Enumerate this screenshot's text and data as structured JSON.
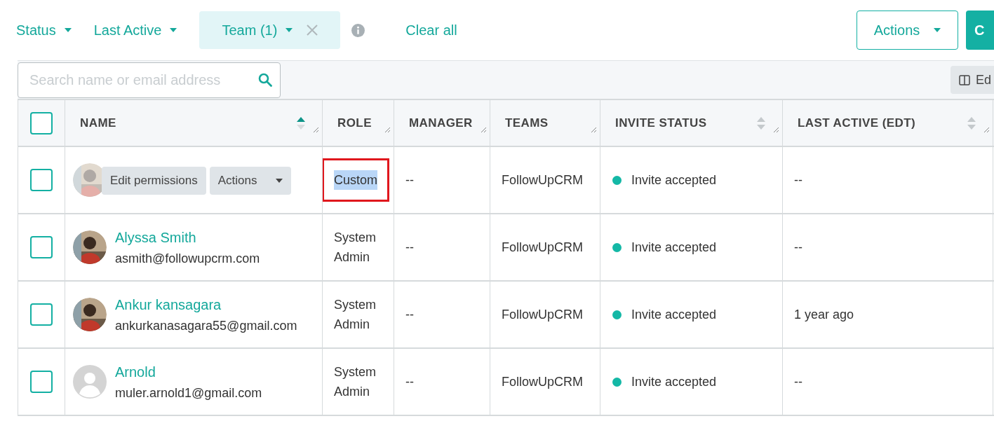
{
  "filters": [
    {
      "label": "Status",
      "active": false,
      "removable": false
    },
    {
      "label": "Last Active",
      "active": false,
      "removable": false
    },
    {
      "label": "Team (1)",
      "active": true,
      "removable": true
    }
  ],
  "clear_all": "Clear all",
  "actions_button": "Actions",
  "primary_button": "C",
  "search": {
    "placeholder": "Search name or email address"
  },
  "edit_columns_button": "Ed",
  "table": {
    "select_all": {
      "checked": false
    },
    "columns": [
      {
        "label": "NAME",
        "sortable": true,
        "sorted_ascending": true
      },
      {
        "label": "ROLE",
        "sortable": false
      },
      {
        "label": "MANAGER",
        "sortable": false
      },
      {
        "label": "TEAMS",
        "sortable": false
      },
      {
        "label": "INVITE STATUS",
        "sortable": true,
        "sorted_ascending": false
      },
      {
        "label": "LAST ACTIVE (EDT)",
        "sortable": true,
        "sorted_ascending": false
      }
    ],
    "rows": [
      {
        "checked": false,
        "avatar": {
          "kind": "picture"
        },
        "hovered": true,
        "row_actions": [
          "Edit permissions",
          "Actions"
        ],
        "role": "Custom",
        "role_highlighted": true,
        "manager": "--",
        "teams": "FollowUpCRM",
        "invite_status": "Invite accepted",
        "color": "#14b8a6",
        "last_active": "--"
      },
      {
        "checked": false,
        "avatar": {
          "kind": "picture"
        },
        "hovered": false,
        "name": "Alyssa Smith",
        "email": "asmith@followupcrm.com",
        "role": "System Admin",
        "role_highlighted": false,
        "manager": "--",
        "teams": "FollowUpCRM",
        "invite_status": "Invite accepted",
        "color": "#14b8a6",
        "last_active": "--"
      },
      {
        "checked": false,
        "avatar": {
          "kind": "picture"
        },
        "hovered": false,
        "name": "Ankur kansagara",
        "email": "ankurkanasagara55@gmail.com",
        "role": "System Admin",
        "role_highlighted": false,
        "manager": "--",
        "teams": "FollowUpCRM",
        "invite_status": "Invite accepted",
        "color": "#14b8a6",
        "last_active": "1 year ago"
      },
      {
        "checked": false,
        "avatar": {
          "kind": "silhouette"
        },
        "hovered": false,
        "name": "Arnold",
        "email": "muler.arnold1@gmail.com",
        "role": "System Admin",
        "role_highlighted": false,
        "manager": "--",
        "teams": "FollowUpCRM",
        "invite_status": "Invite accepted",
        "color": "#14b8a6",
        "last_active": "--"
      }
    ]
  }
}
